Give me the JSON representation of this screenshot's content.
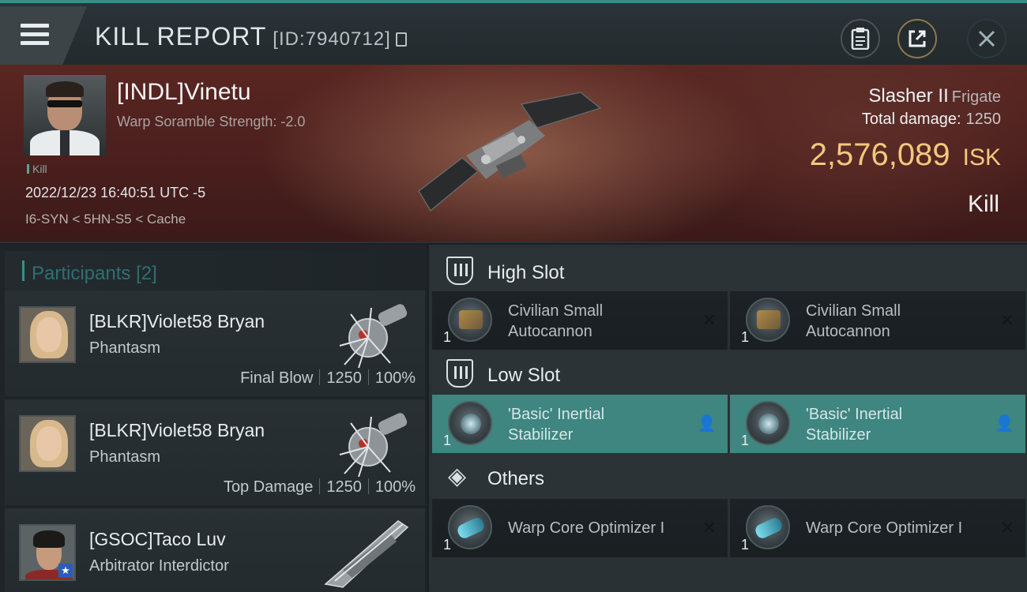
{
  "header": {
    "title": "KILL REPORT",
    "report_id": "[ID:7940712]"
  },
  "icons": {
    "menu": "hamburger-menu-icon",
    "clipboard": "clipboard-icon",
    "share": "share-icon",
    "close": "close-icon"
  },
  "victim": {
    "name": "[INDL]Vinetu",
    "subtitle": "Warp Soramble Strength: -2.0",
    "tag": "Kill",
    "timestamp": "2022/12/23 16:40:51 UTC -5",
    "location": "I6-SYN < 5HN-S5 < Cache",
    "ship": "Slasher II",
    "ship_class": "Frigate",
    "total_damage_label": "Total damage:",
    "total_damage": "1250",
    "isk_value": "2,576,089",
    "isk_currency": "ISK",
    "result": "Kill"
  },
  "participants": {
    "label": "Participants",
    "count": "[2]",
    "items": [
      {
        "name": "[BLKR]Violet58 Bryan",
        "ship": "Phantasm",
        "role": "Final Blow",
        "damage": "1250",
        "percent": "100%"
      },
      {
        "name": "[BLKR]Violet58 Bryan",
        "ship": "Phantasm",
        "role": "Top Damage",
        "damage": "1250",
        "percent": "100%"
      },
      {
        "name": "[GSOC]Taco Luv",
        "ship": "Arbitrator Interdictor"
      }
    ]
  },
  "fitting": {
    "high_slot": {
      "label": "High Slot",
      "modules": [
        {
          "line1": "Civilian Small",
          "line2": "Autocannon",
          "qty": "1",
          "status": "destroyed"
        },
        {
          "line1": "Civilian Small",
          "line2": "Autocannon",
          "qty": "1",
          "status": "destroyed"
        }
      ]
    },
    "low_slot": {
      "label": "Low Slot",
      "modules": [
        {
          "line1": "'Basic' Inertial",
          "line2": "Stabilizer",
          "qty": "1",
          "status": "dropped"
        },
        {
          "line1": "'Basic' Inertial",
          "line2": "Stabilizer",
          "qty": "1",
          "status": "dropped"
        }
      ]
    },
    "others": {
      "label": "Others",
      "modules": [
        {
          "line1": "Warp Core Optimizer I",
          "qty": "1",
          "status": "destroyed"
        },
        {
          "line1": "Warp Core Optimizer I",
          "qty": "1",
          "status": "destroyed"
        }
      ]
    }
  },
  "colors": {
    "accent_teal": "#3f8580",
    "isk_gold": "#f3c87e",
    "banner_red": "#5a2622"
  }
}
